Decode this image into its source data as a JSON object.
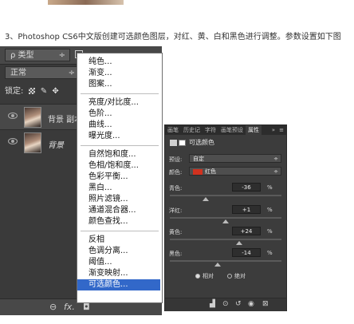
{
  "caption": "3、Photoshop CS6中文版创建可选颜色图层，对红、黄、白和黑色进行调整。参数设置如下图",
  "layers_panel": {
    "kind_filter": "ρ 类型",
    "blend_mode": "正常",
    "lock_label": "锁定:",
    "layers": [
      {
        "name": "背景 副本"
      },
      {
        "name": "背景"
      }
    ],
    "footer_icons": [
      "link-icon",
      "fx-icon",
      "mask-icon",
      "adjustment-icon",
      "folder-icon",
      "new-layer-icon",
      "trash-icon"
    ],
    "fx_label": "fx."
  },
  "adjustment_menu": {
    "groups": [
      [
        "纯色...",
        "渐变...",
        "图案..."
      ],
      [
        "亮度/对比度...",
        "色阶...",
        "曲线...",
        "曝光度..."
      ],
      [
        "自然饱和度...",
        "色相/饱和度...",
        "色彩平衡...",
        "黑白...",
        "照片滤镜...",
        "通道混合器...",
        "颜色查找..."
      ],
      [
        "反相",
        "色调分离...",
        "阈值...",
        "渐变映射...",
        "可选颜色..."
      ]
    ],
    "selected_item": "可选颜色..."
  },
  "properties_panel": {
    "tabs": [
      "画笔",
      "历史记",
      "字符",
      "画笔预设",
      "属性"
    ],
    "active_tab": "属性",
    "title": "可选颜色",
    "preset_label": "预设:",
    "preset_value": "自定",
    "colors_label": "颜色:",
    "colors_value": "红色",
    "colors_swatch": "#d1321f",
    "sliders": [
      {
        "label": "青色:",
        "value": "-36",
        "unit": "%",
        "level": 0.32
      },
      {
        "label": "洋红:",
        "value": "+1",
        "unit": "%",
        "level": 0.5
      },
      {
        "label": "黄色:",
        "value": "+24",
        "unit": "%",
        "level": 0.62
      },
      {
        "label": "黑色:",
        "value": "-14",
        "unit": "%",
        "level": 0.43
      }
    ],
    "method_options": [
      "相对",
      "绝对"
    ],
    "method_selected": "相对"
  }
}
